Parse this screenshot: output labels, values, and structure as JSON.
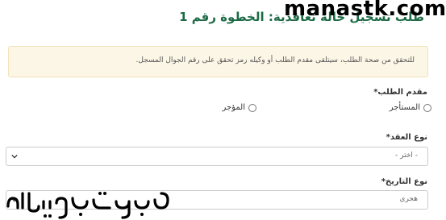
{
  "header": {
    "title": "طلب تسجيل حالة تعاقدية: الخطوة رقم 1",
    "watermark": "manastk.com"
  },
  "alert": {
    "text": "للتحقق من صحة الطلب، سيتلقى مقدم الطلب أو وكيله رمز تحقق على رقم الجوال المسجل."
  },
  "form": {
    "applicant": {
      "label": "مقدم الطلب",
      "required_mark": "*",
      "options": [
        "المستأجر",
        "المؤجر"
      ]
    },
    "contract_type": {
      "label": "نوع العقد",
      "required_mark": "*",
      "value": "- اختر -"
    },
    "date_type": {
      "label": "نوع التاريخ",
      "required_mark": "*",
      "value": "هجري"
    }
  },
  "icons": {
    "chevron": "chevron-down-icon",
    "radio": "radio-unchecked-icon",
    "watermark_logo": "arabic-calligraphy-watermark"
  }
}
